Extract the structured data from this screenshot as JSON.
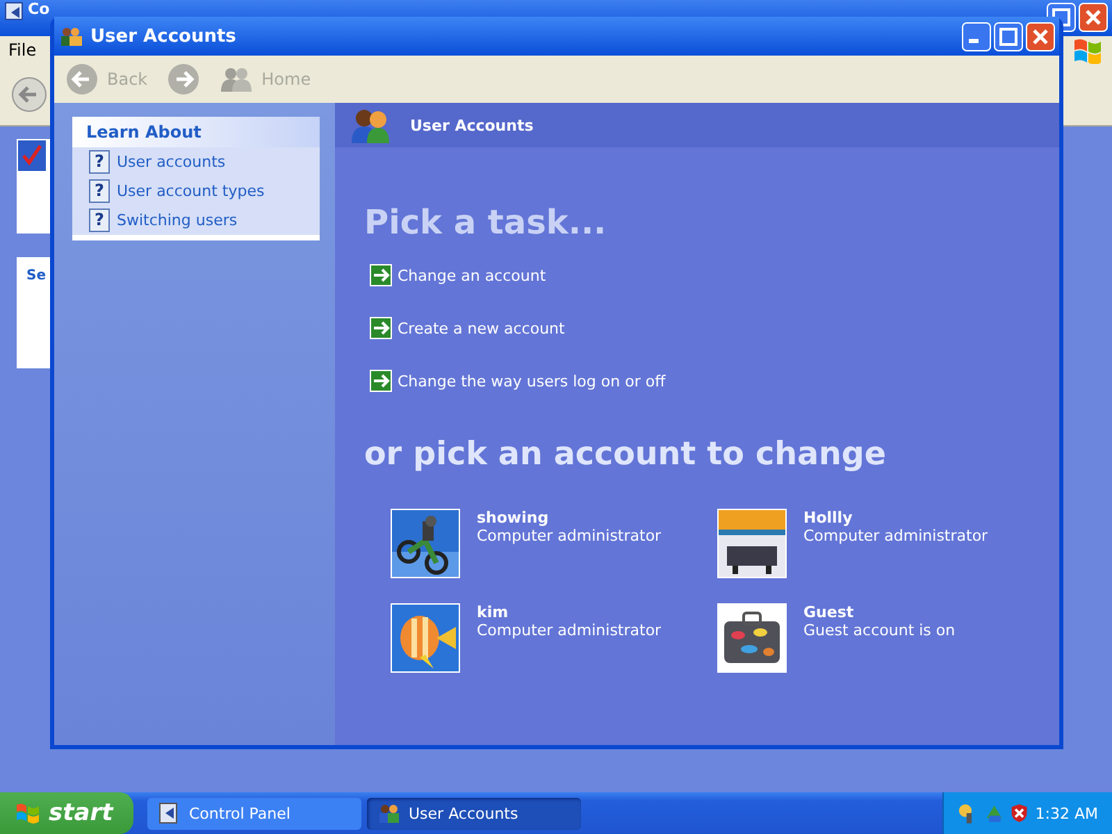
{
  "background_window": {
    "title": "Co",
    "menu": [
      "File"
    ],
    "panel_title": "Se"
  },
  "window": {
    "title": "User Accounts"
  },
  "toolbar": [
    {
      "kind": "back",
      "label": "Back",
      "disabled": true
    },
    {
      "kind": "forward",
      "disabled": true
    },
    {
      "kind": "home",
      "label": "Home",
      "disabled": true
    }
  ],
  "learn_about": {
    "title": "Learn About",
    "items": [
      {
        "icon": "?",
        "label": "User accounts"
      },
      {
        "icon": "?",
        "label": "User account types"
      },
      {
        "icon": "?",
        "label": "Switching users"
      }
    ]
  },
  "header": {
    "title": "User Accounts"
  },
  "tasks": {
    "heading": "Pick a task...",
    "items": [
      "Change an account",
      "Create a new account",
      "Change the way users log on or off"
    ]
  },
  "accounts": {
    "heading": "or pick an account to change",
    "items": [
      {
        "name": "showing",
        "type": "Computer administrator"
      },
      {
        "name": "Hollly",
        "type": "Computer administrator"
      },
      {
        "name": "kim",
        "type": "Computer administrator"
      },
      {
        "name": "Guest",
        "type": "Guest account is on"
      }
    ]
  },
  "taskbar": {
    "start": "start",
    "buttons": [
      {
        "label": "Control Panel",
        "selected": false
      },
      {
        "label": "User Accounts",
        "selected": true
      }
    ],
    "clock": "1:32 AM"
  }
}
